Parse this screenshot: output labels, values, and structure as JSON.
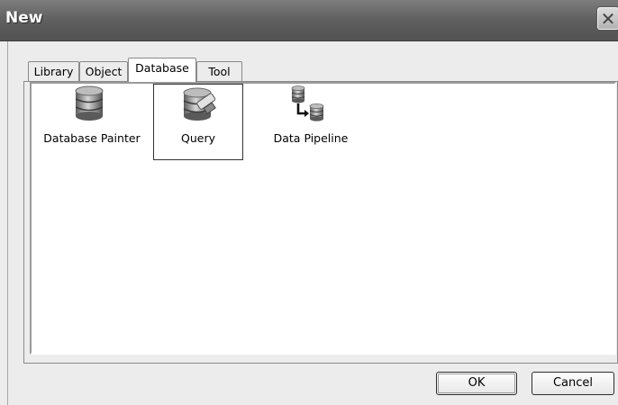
{
  "window": {
    "title": "New",
    "close_label": "✕"
  },
  "tabs": [
    {
      "label": "Library",
      "active": false
    },
    {
      "label": "Object",
      "active": false
    },
    {
      "label": "Database",
      "active": true
    },
    {
      "label": "Tool",
      "active": false
    }
  ],
  "items": [
    {
      "label": "Database Painter",
      "icon": "database-painter-icon",
      "selected": false
    },
    {
      "label": "Query",
      "icon": "query-icon",
      "selected": true
    },
    {
      "label": "Data Pipeline",
      "icon": "data-pipeline-icon",
      "selected": false
    }
  ],
  "buttons": {
    "ok_label": "OK",
    "cancel_label": "Cancel"
  }
}
